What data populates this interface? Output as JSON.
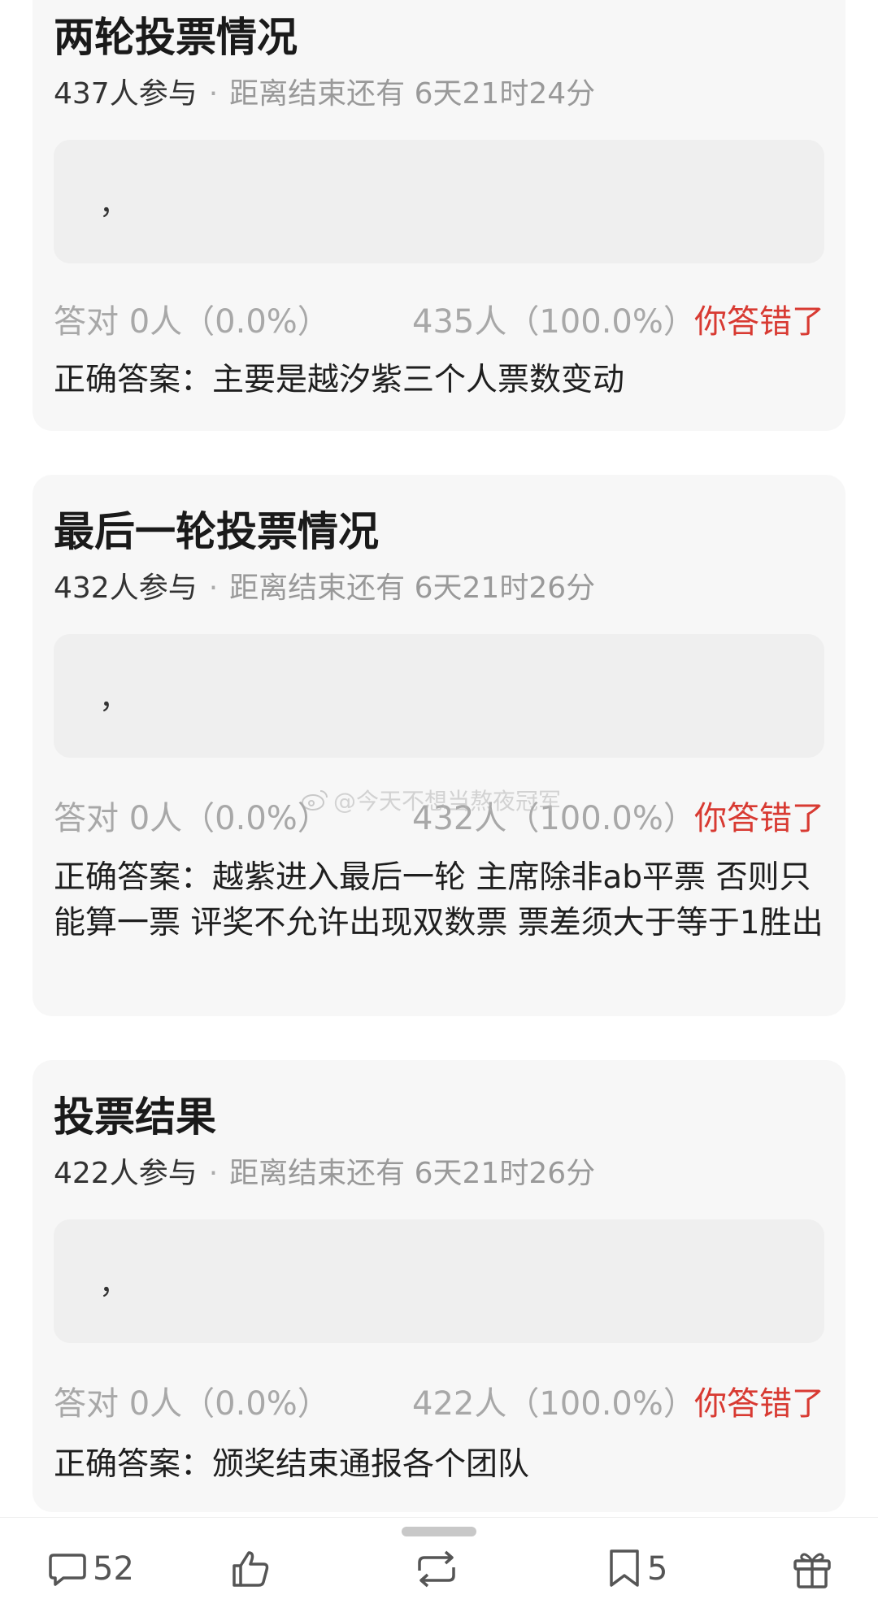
{
  "cards": [
    {
      "title": "两轮投票情况",
      "participants": "437人参与",
      "countdown": "距离结束还有 6天21时24分",
      "option_text": "，",
      "correct_stat": "答对  0人（0.0%）",
      "wrong_stat": "435人（100.0%）",
      "wrong_tag": "你答错了",
      "answer": "正确答案：主要是越汐紫三个人票数变动"
    },
    {
      "title": "最后一轮投票情况",
      "participants": "432人参与",
      "countdown": "距离结束还有 6天21时26分",
      "option_text": "，",
      "correct_stat": "答对  0人（0.0%）",
      "wrong_stat": "432人（100.0%）",
      "wrong_tag": "你答错了",
      "answer": "正确答案：越紫进入最后一轮 主席除非ab平票 否则只能算一票 评奖不允许出现双数票 票差须大于等于1胜出"
    },
    {
      "title": "投票结果",
      "participants": "422人参与",
      "countdown": "距离结束还有 6天21时26分",
      "option_text": "，",
      "correct_stat": "答对  0人（0.0%）",
      "wrong_stat": "422人（100.0%）",
      "wrong_tag": "你答错了",
      "answer": "正确答案：颁奖结束通报各个团队"
    }
  ],
  "watermark": "@今天不想当熬夜冠军",
  "bottom_bar": {
    "comments_count": "52",
    "bookmark_count": "5",
    "icons": [
      "comment-icon",
      "like-icon",
      "repost-icon",
      "bookmark-icon",
      "gift-icon"
    ]
  },
  "colors": {
    "wrong": "#d83a32",
    "card_bg": "#f7f7f7",
    "option_bg": "#efefef"
  }
}
